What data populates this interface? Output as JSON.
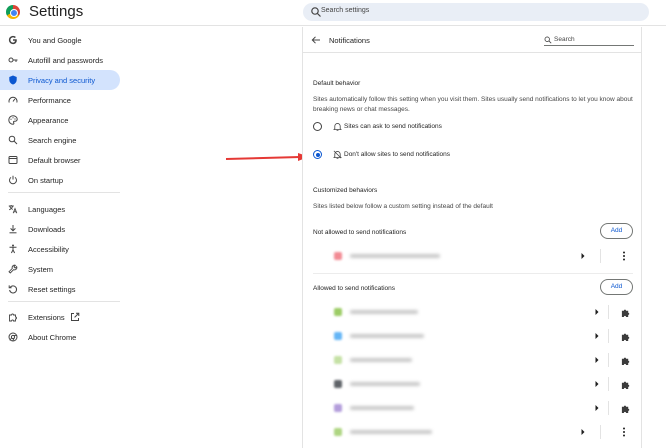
{
  "app": {
    "title": "Settings",
    "search_placeholder": "Search settings"
  },
  "sidebar": {
    "items": [
      {
        "label": "You and Google",
        "icon": "google-icon"
      },
      {
        "label": "Autofill and passwords",
        "icon": "key-icon"
      },
      {
        "label": "Privacy and security",
        "icon": "shield-icon",
        "active": true
      },
      {
        "label": "Performance",
        "icon": "speedometer-icon"
      },
      {
        "label": "Appearance",
        "icon": "palette-icon"
      },
      {
        "label": "Search engine",
        "icon": "search-icon"
      },
      {
        "label": "Default browser",
        "icon": "browser-window-icon"
      },
      {
        "label": "On startup",
        "icon": "power-icon"
      },
      {
        "label": "Languages",
        "icon": "translate-icon"
      },
      {
        "label": "Downloads",
        "icon": "download-icon"
      },
      {
        "label": "Accessibility",
        "icon": "accessibility-icon"
      },
      {
        "label": "System",
        "icon": "wrench-icon"
      },
      {
        "label": "Reset settings",
        "icon": "reset-icon"
      },
      {
        "label": "Extensions",
        "icon": "puzzle-icon"
      },
      {
        "label": "About Chrome",
        "icon": "chrome-icon"
      }
    ]
  },
  "panel": {
    "title": "Notifications",
    "search_placeholder": "Search",
    "default_behavior": {
      "heading": "Default behavior",
      "description": "Sites automatically follow this setting when you visit them. Sites usually send notifications to let you know about breaking news or chat messages.",
      "options": [
        {
          "label": "Sites can ask to send notifications",
          "icon": "bell-icon",
          "selected": false
        },
        {
          "label": "Don't allow sites to send notifications",
          "icon": "bell-off-icon",
          "selected": true
        }
      ]
    },
    "customized": {
      "heading": "Customized behaviors",
      "description": "Sites listed below follow a custom setting instead of the default",
      "not_allowed": {
        "heading": "Not allowed to send notifications",
        "add_label": "Add"
      },
      "allowed": {
        "heading": "Allowed to send notifications",
        "add_label": "Add"
      }
    }
  },
  "colors": {
    "accent": "#0b57d0",
    "active_nav_bg": "#d3e3fd",
    "annotation_arrow": "#e53935",
    "favicons": [
      "#f28b94",
      "#9ccc65",
      "#64b5f6",
      "#c5e1a5",
      "#5f6368",
      "#b39ddb",
      "#aed581"
    ]
  }
}
